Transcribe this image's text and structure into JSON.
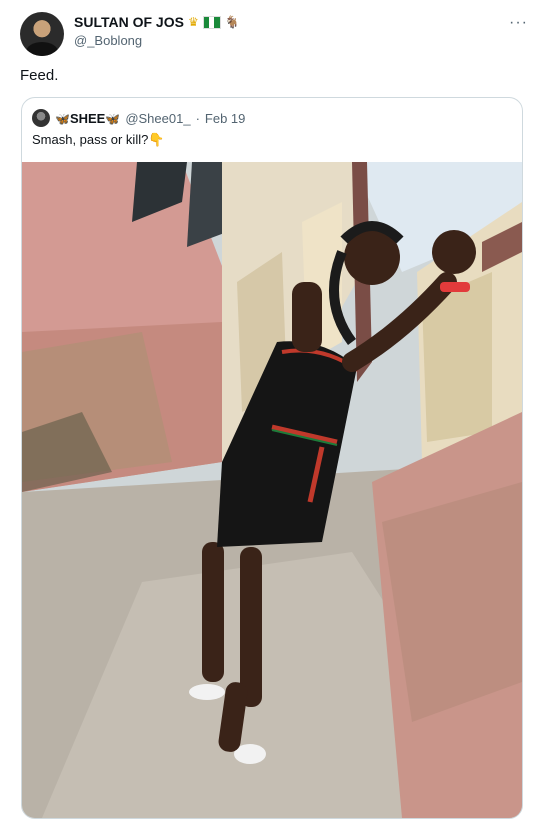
{
  "author": {
    "display_name": "SULTAN OF JOS",
    "handle": "@_Boblong",
    "name_emojis": [
      "crown-emoji",
      "nigeria-flag-emoji",
      "goat-emoji"
    ]
  },
  "tweet": {
    "text": "Feed.",
    "more_icon": "more-horizontal-icon"
  },
  "quoted": {
    "display_name": "SHEE",
    "name_prefix_emoji": "🦋",
    "name_suffix_emoji": "🦋",
    "handle": "@Shee01_",
    "separator": "·",
    "date": "Feb 19",
    "text": "Smash, pass or kill?👇",
    "photo": "photo-woman-in-black-dress-alley"
  },
  "colors": {
    "text_primary": "#0f1419",
    "text_secondary": "#536471",
    "border": "#cfd9de"
  }
}
